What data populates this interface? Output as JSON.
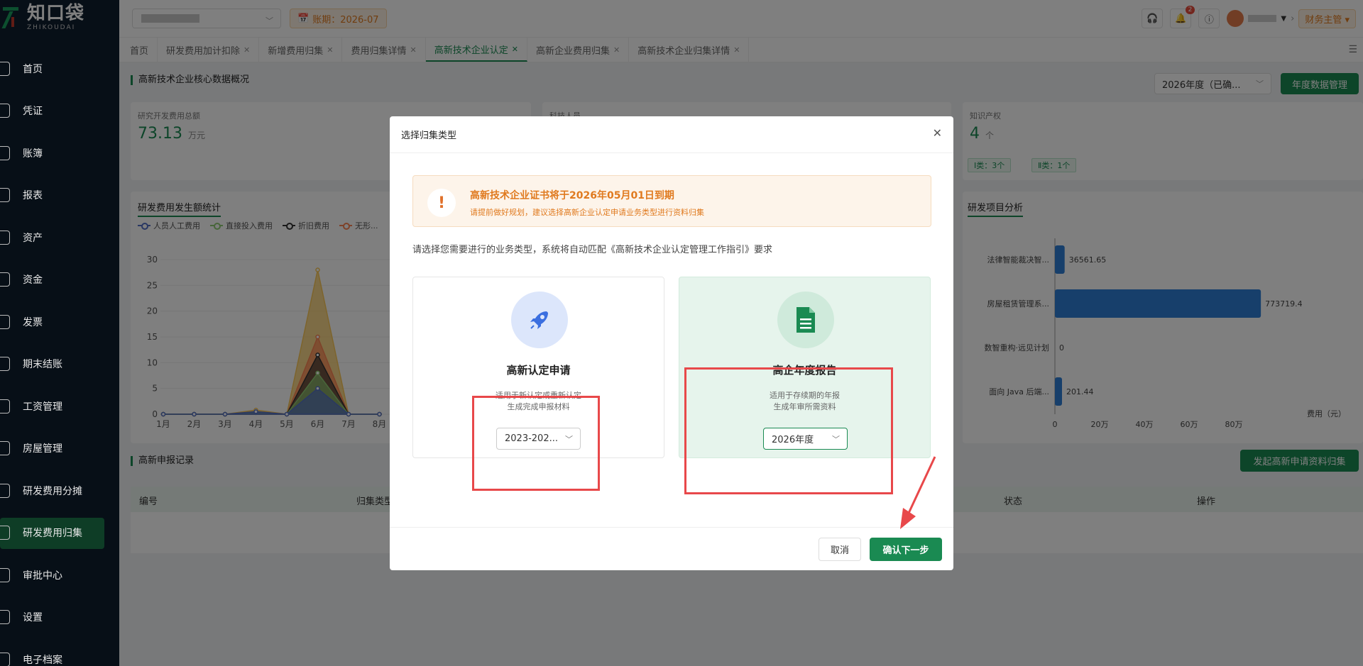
{
  "brand": {
    "name_cn": "知口袋",
    "name_en": "ZHIKOUDAI"
  },
  "sidebar": {
    "items": [
      {
        "label": "首页",
        "icon": "home-icon"
      },
      {
        "label": "凭证",
        "icon": "voucher-icon"
      },
      {
        "label": "账簿",
        "icon": "book-icon"
      },
      {
        "label": "报表",
        "icon": "report-icon"
      },
      {
        "label": "资产",
        "icon": "asset-icon"
      },
      {
        "label": "资金",
        "icon": "fund-icon"
      },
      {
        "label": "发票",
        "icon": "invoice-icon"
      },
      {
        "label": "期末结账",
        "icon": "closing-icon"
      },
      {
        "label": "工资管理",
        "icon": "salary-icon"
      },
      {
        "label": "房屋管理",
        "icon": "house-icon"
      },
      {
        "label": "研发费用分摊",
        "icon": "allocation-icon"
      },
      {
        "label": "研发费用归集",
        "icon": "collection-icon",
        "active": true
      },
      {
        "label": "审批中心",
        "icon": "approval-icon"
      },
      {
        "label": "设置",
        "icon": "settings-icon"
      },
      {
        "label": "电子档案",
        "icon": "archive-icon"
      }
    ]
  },
  "topbar": {
    "period": "账期：2026-07",
    "badge": "2",
    "role": "财务主管"
  },
  "tabs": [
    {
      "label": "首页",
      "closable": false
    },
    {
      "label": "研发费用加计扣除",
      "closable": true
    },
    {
      "label": "新增费用归集",
      "closable": true
    },
    {
      "label": "费用归集详情",
      "closable": true
    },
    {
      "label": "高新技术企业认定",
      "closable": true,
      "active": true
    },
    {
      "label": "高新企业费用归集",
      "closable": true
    },
    {
      "label": "高新技术企业归集详情",
      "closable": true
    }
  ],
  "main": {
    "overview_title": "高新技术企业核心数据概况",
    "year_select": "2026年度（已确...",
    "year_manage_btn": "年度数据管理",
    "cards": [
      {
        "label": "研究开发费用总额",
        "value": "73.13",
        "unit": "万元"
      },
      {
        "label": "科技人员",
        "value": "",
        "unit": ""
      },
      {
        "label": "知识产权",
        "value": "4",
        "unit": "个"
      }
    ],
    "ip_tags": [
      "Ⅰ类：3个",
      "Ⅱ类：1个"
    ],
    "rd_chart_title": "研发费用发生额统计",
    "project_chart_title": "研发项目分析",
    "records_title": "高新申报记录",
    "start_btn": "发起高新申请资料归集",
    "table_headers": [
      "编号",
      "归集类型",
      "状态",
      "操作"
    ]
  },
  "chart_data": [
    {
      "type": "area",
      "title": "研发费用发生额统计",
      "categories": [
        "1月",
        "2月",
        "3月",
        "4月",
        "5月",
        "6月",
        "7月",
        "8月"
      ],
      "ylim": [
        0,
        30
      ],
      "yticks": [
        "30",
        "25",
        "20",
        "15",
        "10",
        "5",
        "0"
      ],
      "series": [
        {
          "name": "人员人工费用",
          "color": "#5470c6",
          "values": [
            0,
            0,
            0,
            0.5,
            0,
            5,
            0,
            0
          ]
        },
        {
          "name": "直接投入费用",
          "color": "#91cc75",
          "values": [
            0,
            0,
            0,
            0.3,
            0,
            8,
            0,
            0
          ]
        },
        {
          "name": "折旧费用",
          "color": "#333333",
          "values": [
            0,
            0,
            0,
            0.3,
            0,
            11.5,
            0,
            0
          ]
        },
        {
          "name": "无形...",
          "color": "#fc8452",
          "values": [
            0,
            0,
            0,
            0.3,
            0,
            15,
            0,
            0
          ]
        },
        {
          "name": "",
          "color": "#fac858",
          "values": [
            0,
            0,
            0,
            0.8,
            0,
            28,
            0,
            0
          ]
        }
      ]
    },
    {
      "type": "bar",
      "title": "研发项目分析",
      "orientation": "horizontal",
      "categories": [
        "法律智能裁决智...",
        "房屋租赁管理系...",
        "数智重构·远见计划",
        "面向 Java 后端..."
      ],
      "values": [
        36561.65,
        773719.4,
        0,
        201.44
      ],
      "value_labels": [
        "36561.65",
        "773719.4",
        "0",
        "201.44"
      ],
      "xticks": [
        "0",
        "20万",
        "40万",
        "60万",
        "80万"
      ],
      "xlim": [
        0,
        800000
      ],
      "xlabel": "费用（元）"
    }
  ],
  "dialog": {
    "title": "选择归集类型",
    "warning_title": "高新技术企业证书将于2026年05月01日到期",
    "warning_sub": "请提前做好规划，建议选择高新企业认定申请业务类型进行资料归集",
    "description": "请选择您需要进行的业务类型，系统将自动匹配《高新技术企业认定管理工作指引》要求",
    "options": [
      {
        "title": "高新认定申请",
        "desc1": "适用于新认定或重新认定",
        "desc2": "生成完成申报材料",
        "select": "2023-202...",
        "icon": "rocket-icon",
        "icon_color": "#3b6fe0",
        "icon_bg": "#dce6fb"
      },
      {
        "title": "高企年度报告",
        "desc1": "适用于存续期的年报",
        "desc2": "生成年审所需资料",
        "select": "2026年度",
        "icon": "document-icon",
        "icon_color": "#1a8a52",
        "icon_bg": "#cfeadb",
        "selected": true
      }
    ],
    "cancel": "取消",
    "confirm": "确认下一步"
  }
}
